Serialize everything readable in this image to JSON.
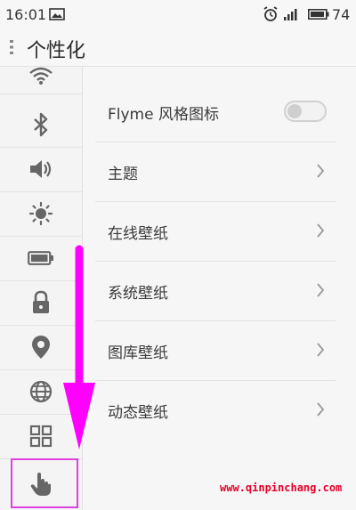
{
  "status_bar": {
    "time": "16:01",
    "battery_level": "74",
    "icons": [
      "gallery-icon",
      "alarm-icon",
      "signal-icon",
      "battery-icon"
    ]
  },
  "header": {
    "title": "个性化",
    "menu_icon": "menu-dots-icon"
  },
  "sidebar": {
    "items": [
      {
        "icon": "wifi-icon"
      },
      {
        "icon": "bluetooth-icon"
      },
      {
        "icon": "volume-icon"
      },
      {
        "icon": "brightness-icon"
      },
      {
        "icon": "battery-icon"
      },
      {
        "icon": "lock-icon"
      },
      {
        "icon": "location-icon"
      },
      {
        "icon": "globe-icon"
      },
      {
        "icon": "apps-grid-icon"
      },
      {
        "icon": "hand-gesture-icon",
        "selected": true
      }
    ]
  },
  "settings": {
    "items": [
      {
        "label": "Flyme 风格图标",
        "control": "toggle",
        "toggle_on": false
      },
      {
        "label": "主题",
        "control": "chevron"
      },
      {
        "label": "在线壁纸",
        "control": "chevron"
      },
      {
        "label": "系统壁纸",
        "control": "chevron"
      },
      {
        "label": "图库壁纸",
        "control": "chevron"
      },
      {
        "label": "动态壁纸",
        "control": "chevron"
      }
    ]
  },
  "annotation": {
    "arrow_color": "#ff00ff",
    "highlight_color": "#e040e0"
  },
  "watermark": "www.qinpinchang.com"
}
